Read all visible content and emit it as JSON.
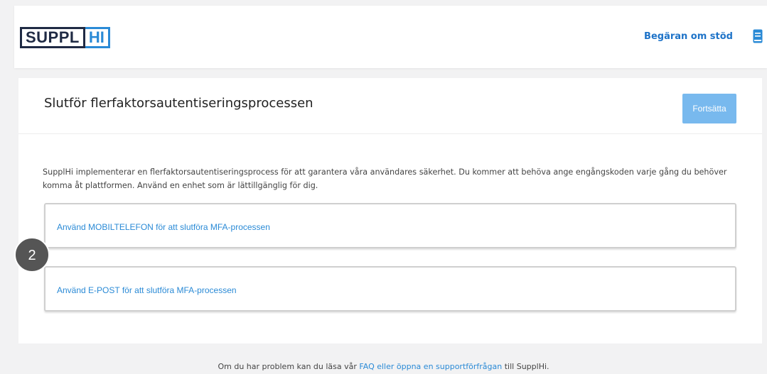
{
  "header": {
    "logo": {
      "part1": "SUPPL",
      "part2": "HI"
    },
    "support_link": "Begäran om stöd",
    "book_icon": "book-icon"
  },
  "card": {
    "title": "Slutför flerfaktorsautentiseringsprocessen",
    "continue_button": "Fortsätta",
    "description": "SupplHi implementerar en flerfaktorsautentiseringsprocess för att garantera våra användares säkerhet. Du kommer att behöva ange engångskoden varje gång du behöver komma åt plattformen. Använd en enhet som är lättillgänglig för dig.",
    "options": [
      {
        "label": "Använd MOBILTELEFON för att slutföra MFA-processen"
      },
      {
        "label": "Använd E-POST för att slutföra MFA-processen"
      }
    ]
  },
  "step_badge": "2",
  "footer": {
    "prefix": "Om du har problem kan du läsa vår",
    "link_faq": "FAQ eller öppna en supportförfrågan",
    "suffix": "till SupplHi."
  },
  "colors": {
    "accent": "#2a8ad6",
    "button": "#78b9ee",
    "logo_dark": "#1f2a44"
  }
}
